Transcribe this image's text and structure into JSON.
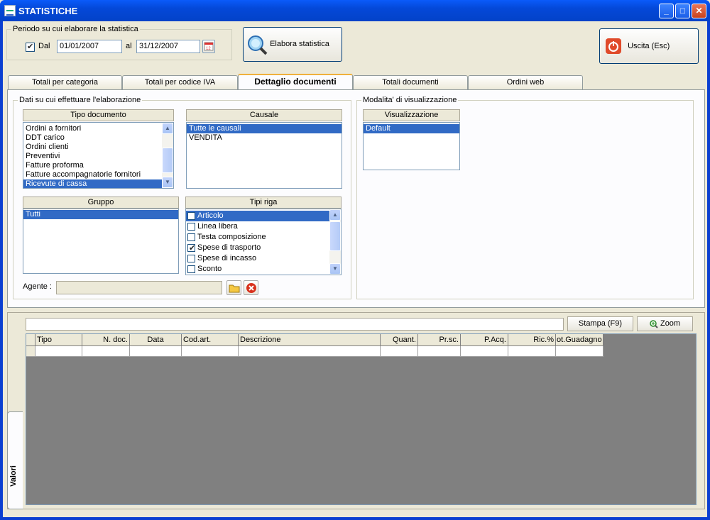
{
  "window": {
    "title": "STATISTICHE",
    "minimize": "_",
    "maximize": "□",
    "close": "✕"
  },
  "period": {
    "legend": "Periodo su cui elaborare la statistica",
    "dal_label": "Dal",
    "dal_checked": true,
    "from_date": "01/01/2007",
    "al_label": "al",
    "to_date": "31/12/2007"
  },
  "buttons": {
    "elabora": "Elabora statistica",
    "uscita": "Uscita (Esc)",
    "stampa": "Stampa (F9)",
    "zoom": "Zoom"
  },
  "tabs": [
    "Totali per categoria",
    "Totali per codice IVA",
    "Dettaglio documenti",
    "Totali documenti",
    "Ordini web"
  ],
  "active_tab": "Dettaglio documenti",
  "dati": {
    "legend": "Dati su cui effettuare l'elaborazione",
    "tipo_documento": {
      "header": "Tipo documento",
      "items": [
        "Ordini a fornitori",
        "DDT carico",
        "Ordini clienti",
        "Preventivi",
        "Fatture proforma",
        "Fatture accompagnatorie fornitori",
        "Ricevute di cassa"
      ],
      "selected": "Ricevute di cassa"
    },
    "causale": {
      "header": "Causale",
      "items": [
        "Tutte le causali",
        "VENDITA"
      ],
      "selected": "Tutte le causali"
    },
    "gruppo": {
      "header": "Gruppo",
      "items": [
        "Tutti"
      ],
      "selected": "Tutti"
    },
    "tipi_riga": {
      "header": "Tipi riga",
      "items": [
        {
          "label": "Articolo",
          "checked": false,
          "selected": true
        },
        {
          "label": "Linea libera",
          "checked": false,
          "selected": false
        },
        {
          "label": "Testa composizione",
          "checked": false,
          "selected": false
        },
        {
          "label": "Spese di trasporto",
          "checked": true,
          "selected": false
        },
        {
          "label": "Spese di incasso",
          "checked": false,
          "selected": false
        },
        {
          "label": "Sconto",
          "checked": false,
          "selected": false
        }
      ]
    },
    "agente_label": "Agente :",
    "agente_value": ""
  },
  "modalita": {
    "legend": "Modalita' di visualizzazione",
    "header": "Visualizzazione",
    "items": [
      "Default"
    ],
    "selected": "Default"
  },
  "valori": {
    "side_tab": "Valori",
    "filter_value": "",
    "columns": [
      "Tipo",
      "N. doc.",
      "Data",
      "Cod.art.",
      "Descrizione",
      "Quant.",
      "Pr.sc.",
      "P.Acq.",
      "Ric.%",
      "ot.Guadagno"
    ],
    "column_align": [
      "left",
      "right",
      "center",
      "left",
      "left",
      "right",
      "right",
      "right",
      "right",
      "left"
    ]
  },
  "colors": {
    "selection": "#316ac5",
    "titlebar": "#0448d8",
    "grid_background": "#808080",
    "window_bg": "#ece9d8"
  }
}
